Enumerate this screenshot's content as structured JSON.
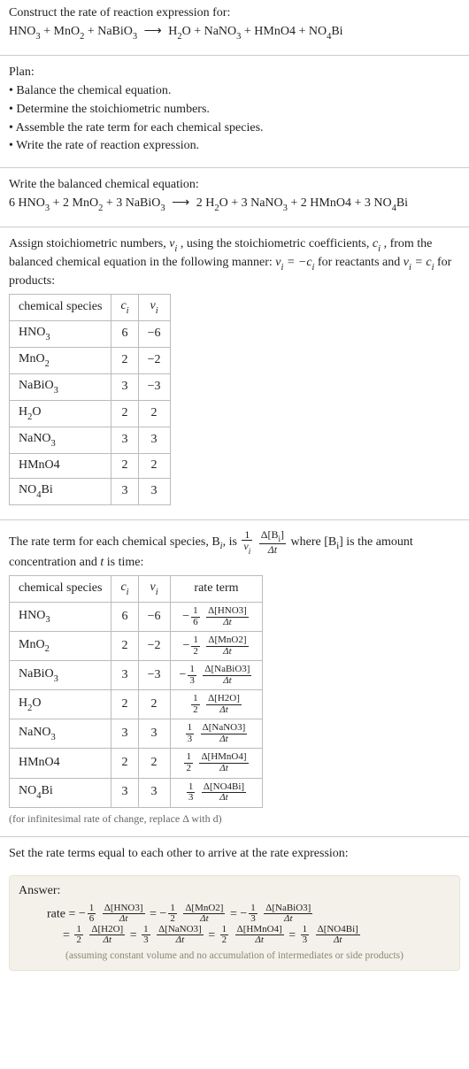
{
  "problem": {
    "title": "Construct the rate of reaction expression for:",
    "lhs": "HNO_3 + MnO_2 + NaBiO_3",
    "arrow": "⟶",
    "rhs": "H_2O + NaNO_3 + HMnO4 + NO_4Bi"
  },
  "plan": {
    "title": "Plan:",
    "items": [
      "Balance the chemical equation.",
      "Determine the stoichiometric numbers.",
      "Assemble the rate term for each chemical species.",
      "Write the rate of reaction expression."
    ]
  },
  "balanced": {
    "title": "Write the balanced chemical equation:",
    "lhs": "6 HNO_3 + 2 MnO_2 + 3 NaBiO_3",
    "arrow": "⟶",
    "rhs": "2 H_2O + 3 NaNO_3 + 2 HMnO4 + 3 NO_4Bi"
  },
  "assign": {
    "intro_a": "Assign stoichiometric numbers, ",
    "nu_i": "ν_i",
    "intro_b": ", using the stoichiometric coefficients, ",
    "c_i": "c_i",
    "intro_c": ", from the balanced chemical equation in the following manner: ",
    "rule_react": "ν_i = −c_i",
    "for_react": " for reactants and ",
    "rule_prod": "ν_i = c_i",
    "for_prod": " for products:"
  },
  "tbl1": {
    "headers": [
      "chemical species",
      "c_i",
      "ν_i"
    ],
    "rows": [
      {
        "sp": "HNO_3",
        "c": "6",
        "nu": "−6"
      },
      {
        "sp": "MnO_2",
        "c": "2",
        "nu": "−2"
      },
      {
        "sp": "NaBiO_3",
        "c": "3",
        "nu": "−3"
      },
      {
        "sp": "H_2O",
        "c": "2",
        "nu": "2"
      },
      {
        "sp": "NaNO_3",
        "c": "3",
        "nu": "3"
      },
      {
        "sp": "HMnO4",
        "c": "2",
        "nu": "2"
      },
      {
        "sp": "NO_4Bi",
        "c": "3",
        "nu": "3"
      }
    ]
  },
  "rateterm_intro": {
    "a": "The rate term for each chemical species, B",
    "i": "i",
    "b": ", is ",
    "frac1_num": "1",
    "frac1_den": "ν_i",
    "frac2_num": "Δ[B_i]",
    "frac2_den": "Δt",
    "c": " where [B_i] is the amount concentration and ",
    "t": "t",
    "d": " is time:"
  },
  "tbl2": {
    "headers": [
      "chemical species",
      "c_i",
      "ν_i",
      "rate term"
    ],
    "rows": [
      {
        "sp": "HNO_3",
        "c": "6",
        "nu": "−6",
        "sign": "−",
        "a": "1",
        "b": "6",
        "d": "Δ[HNO3]"
      },
      {
        "sp": "MnO_2",
        "c": "2",
        "nu": "−2",
        "sign": "−",
        "a": "1",
        "b": "2",
        "d": "Δ[MnO2]"
      },
      {
        "sp": "NaBiO_3",
        "c": "3",
        "nu": "−3",
        "sign": "−",
        "a": "1",
        "b": "3",
        "d": "Δ[NaBiO3]"
      },
      {
        "sp": "H_2O",
        "c": "2",
        "nu": "2",
        "sign": "",
        "a": "1",
        "b": "2",
        "d": "Δ[H2O]"
      },
      {
        "sp": "NaNO_3",
        "c": "3",
        "nu": "3",
        "sign": "",
        "a": "1",
        "b": "3",
        "d": "Δ[NaNO3]"
      },
      {
        "sp": "HMnO4",
        "c": "2",
        "nu": "2",
        "sign": "",
        "a": "1",
        "b": "2",
        "d": "Δ[HMnO4]"
      },
      {
        "sp": "NO_4Bi",
        "c": "3",
        "nu": "3",
        "sign": "",
        "a": "1",
        "b": "3",
        "d": "Δ[NO4Bi]"
      }
    ],
    "dt": "Δt"
  },
  "deriv_note": "(for infinitesimal rate of change, replace Δ with d)",
  "set_equal": "Set the rate terms equal to each other to arrive at the rate expression:",
  "answer": {
    "title": "Answer:",
    "rate_label": "rate = ",
    "terms": [
      {
        "sign": "−",
        "a": "1",
        "b": "6",
        "d": "Δ[HNO3]"
      },
      {
        "sign": "−",
        "a": "1",
        "b": "2",
        "d": "Δ[MnO2]"
      },
      {
        "sign": "−",
        "a": "1",
        "b": "3",
        "d": "Δ[NaBiO3]"
      },
      {
        "sign": "",
        "a": "1",
        "b": "2",
        "d": "Δ[H2O]"
      },
      {
        "sign": "",
        "a": "1",
        "b": "3",
        "d": "Δ[NaNO3]"
      },
      {
        "sign": "",
        "a": "1",
        "b": "2",
        "d": "Δ[HMnO4]"
      },
      {
        "sign": "",
        "a": "1",
        "b": "3",
        "d": "Δ[NO4Bi]"
      }
    ],
    "dt": "Δt",
    "eq": " = ",
    "note": "(assuming constant volume and no accumulation of intermediates or side products)"
  },
  "chart_data": null
}
